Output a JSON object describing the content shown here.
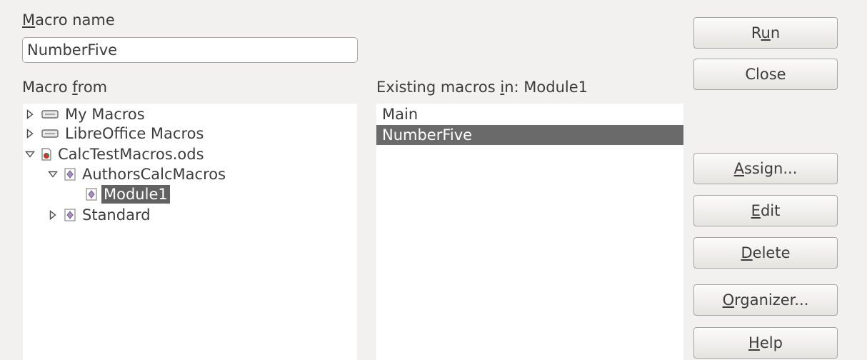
{
  "dialog": {
    "macro_name_label": {
      "mnemonic": "M",
      "rest": "acro name"
    },
    "macro_name_value": "NumberFive",
    "macro_from_label": {
      "before": "Macro ",
      "mnemonic": "f",
      "after": "rom"
    },
    "existing_label": {
      "before": "Existing macros ",
      "mnemonic": "i",
      "after": "n: Module1"
    }
  },
  "tree": [
    {
      "label": "My Macros",
      "expander": "collapsed",
      "icon": "library-icon",
      "level": 0,
      "selected": false
    },
    {
      "label": "LibreOffice Macros",
      "expander": "collapsed",
      "icon": "library-icon",
      "level": 0,
      "selected": false
    },
    {
      "label": "CalcTestMacros.ods",
      "expander": "expanded",
      "icon": "spreadsheet-doc-icon",
      "level": 0,
      "selected": false
    },
    {
      "label": "AuthorsCalcMacros",
      "expander": "expanded",
      "icon": "basic-library-icon",
      "level": 1,
      "selected": false
    },
    {
      "label": "Module1",
      "expander": "none",
      "icon": "basic-module-icon",
      "level": 2,
      "selected": true
    },
    {
      "label": "Standard",
      "expander": "collapsed",
      "icon": "basic-library-icon",
      "level": 1,
      "selected": false
    }
  ],
  "macros": [
    {
      "label": "Main",
      "selected": false
    },
    {
      "label": "NumberFive",
      "selected": true
    }
  ],
  "buttons": {
    "run": {
      "before": "R",
      "mnemonic": "u",
      "after": "n"
    },
    "close": {
      "before": "Close",
      "mnemonic": "",
      "after": ""
    },
    "assign": {
      "before": "",
      "mnemonic": "A",
      "after": "ssign..."
    },
    "edit": {
      "before": "",
      "mnemonic": "E",
      "after": "dit"
    },
    "delete": {
      "before": "",
      "mnemonic": "D",
      "after": "elete"
    },
    "organizer": {
      "before": "",
      "mnemonic": "O",
      "after": "rganizer..."
    },
    "help": {
      "before": "",
      "mnemonic": "H",
      "after": "elp"
    }
  },
  "colors": {
    "dialog_bg": "#f2f1f0",
    "selection": "#626262",
    "list_bg": "#ffffff"
  }
}
